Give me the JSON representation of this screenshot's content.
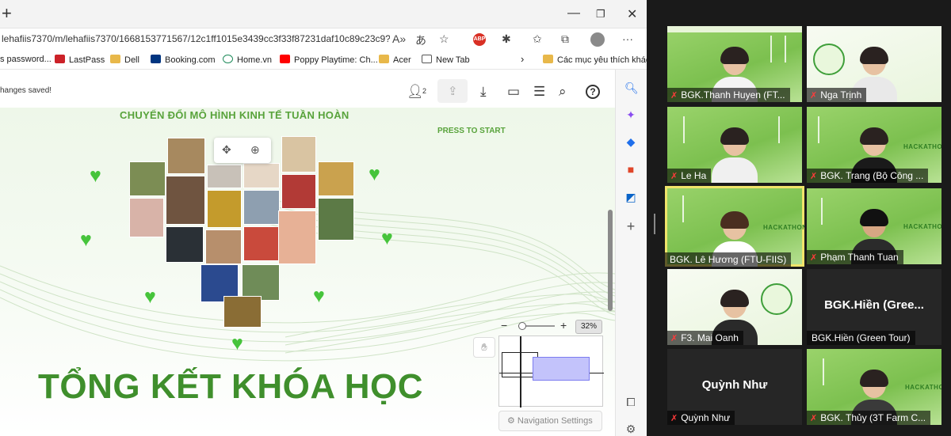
{
  "browser": {
    "url": "lehafiis7370/m/lehafiis7370/1668153771567/12c1ff1015e3439cc3f33f87231daf10c89c23c9?se...",
    "bookmarks": [
      {
        "label": "s password...",
        "icon": "none"
      },
      {
        "label": "LastPass",
        "icon": "lastpass"
      },
      {
        "label": "Dell",
        "icon": "folder"
      },
      {
        "label": "Booking.com",
        "icon": "booking"
      },
      {
        "label": "Home.vn",
        "icon": "home"
      },
      {
        "label": "Poppy Playtime: Ch...",
        "icon": "youtube"
      },
      {
        "label": "Acer",
        "icon": "folder"
      },
      {
        "label": "New Tab",
        "icon": "page"
      },
      {
        "label": "Các mục yêu thích khác",
        "icon": "folder"
      }
    ]
  },
  "app": {
    "saved_status": "hanges saved!",
    "user_count": "2",
    "slide_title": "CHUYỂN ĐỔI MÔ HÌNH KINH TẾ TUẦN HOÀN",
    "press_to_start": "PRESS TO START",
    "big_title": "TỔNG KẾT KHÓA HỌC",
    "zoom_percent": "32%",
    "navigation_settings": "Navigation Settings"
  },
  "participants": [
    {
      "name": "BGK.Thanh Huyen (FT...",
      "muted": true,
      "background": "green"
    },
    {
      "name": "Nga Trịnh",
      "muted": true,
      "background": "white"
    },
    {
      "name": "Le Ha",
      "muted": true,
      "background": "green"
    },
    {
      "name": "BGK. Trang (Bộ Công ...",
      "muted": true,
      "background": "green"
    },
    {
      "name": "BGK. Lê Hương (FTU-FIIS)",
      "muted": false,
      "background": "green",
      "active": true
    },
    {
      "name": "Phạm Thanh Tuan",
      "muted": true,
      "background": "green"
    },
    {
      "name": "F3. Mai Oanh",
      "muted": true,
      "background": "white"
    },
    {
      "name": "BGK.Hiền (Green Tour)",
      "muted": false,
      "background": "dark",
      "center_name": "BGK.Hiền  (Gree..."
    },
    {
      "name": "Quỳnh Như",
      "muted": true,
      "background": "dark",
      "center_name": "Quỳnh Như"
    },
    {
      "name": "BGK. Thủy (3T Farm C...",
      "muted": true,
      "background": "green"
    }
  ],
  "colors": {
    "accent_green": "#46c43b",
    "title_green": "#3f8f2c",
    "active_speaker": "#f0e46a",
    "muted_red": "#ff3b3b"
  }
}
